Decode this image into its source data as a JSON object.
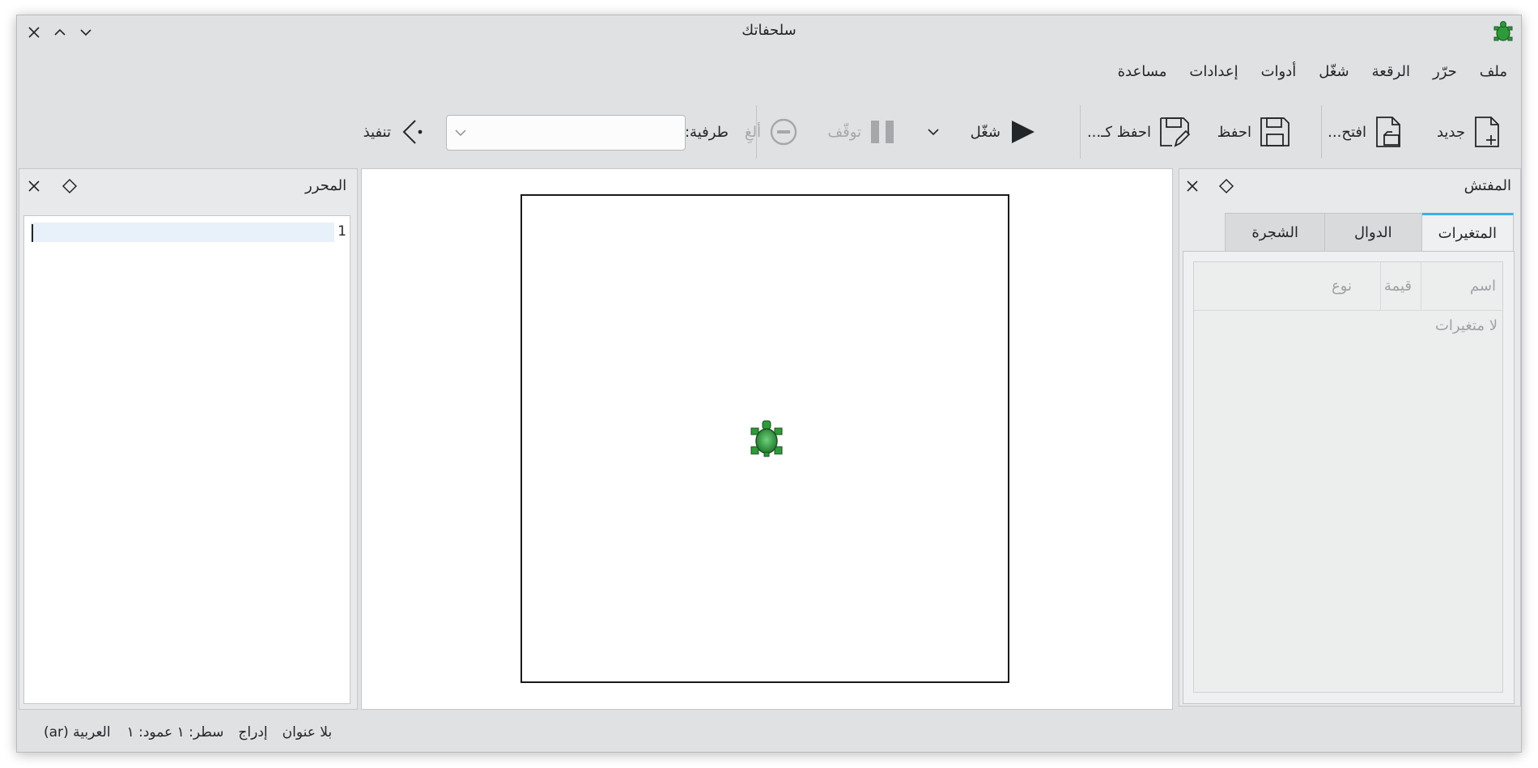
{
  "window": {
    "title": "سلحفاتك"
  },
  "menu": {
    "items": [
      "ملف",
      "حرّر",
      "الرقعة",
      "شغّل",
      "أدوات",
      "إعدادات",
      "مساعدة"
    ]
  },
  "toolbar": {
    "new_label": "جديد",
    "open_label": "افتح...",
    "save_label": "احفظ",
    "save_as_label": "احفظ كـ...",
    "run_label": "شغّل",
    "pause_label": "توقّف",
    "abort_label": "ألغِ",
    "terminal_label": "طرفية:",
    "terminal_value": "",
    "execute_label": "تنفيذ"
  },
  "inspector": {
    "title": "المفتش",
    "tabs": [
      "المتغيرات",
      "الدوال",
      "الشجرة"
    ],
    "active_tab": 0,
    "columns": [
      "اسم",
      "قيمة",
      "نوع"
    ],
    "empty_text": "لا متغيرات"
  },
  "editor": {
    "title": "المحرر",
    "line_numbers": [
      "1"
    ]
  },
  "statusbar": {
    "language": "العربية (ar)",
    "position": "سطر: ١ عمود: ١",
    "mode": "إدراج",
    "document": "بلا عنوان"
  },
  "colors": {
    "accent": "#3daee9",
    "window_bg": "#dfe1e3",
    "turtle_green": "#2e9a3a"
  }
}
